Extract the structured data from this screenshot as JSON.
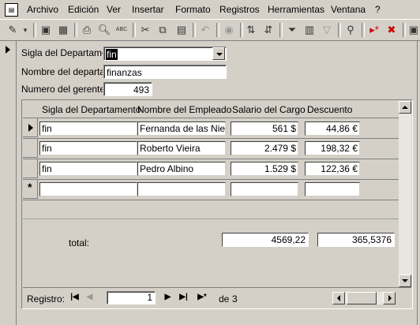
{
  "menu": {
    "items": [
      "Archivo",
      "Edición",
      "Ver",
      "Insertar",
      "Formato",
      "Registros",
      "Herramientas",
      "Ventana",
      "?"
    ]
  },
  "toolbar": {
    "icons": [
      "design-view-icon",
      "save-icon",
      "print-preview-icon",
      "print-icon",
      "preview-icon",
      "spelling-icon",
      "cut-icon",
      "copy-icon",
      "paste-icon",
      "undo-icon",
      "hyperlink-icon",
      "sort-asc-icon",
      "sort-desc-icon",
      "filter-selection-icon",
      "filter-form-icon",
      "apply-filter-icon",
      "find-icon",
      "new-record-icon",
      "delete-record-icon",
      "database-window-icon"
    ],
    "spelling_glyph": "ABC"
  },
  "form": {
    "sigla_label": "Sigla del Departamen",
    "sigla_value": "fin",
    "nombre_label": "Nombre del departam",
    "nombre_value": "finanzas",
    "gerente_label": "Numero del gerente",
    "gerente_value": "493"
  },
  "subform": {
    "headers": [
      "Sigla del Departamento",
      "Nombre del Empleado",
      "Salario del Cargo",
      "Descuento"
    ],
    "rows": [
      {
        "sigla": "fin",
        "nombre": "Fernanda de las Nieve",
        "salario": "561 $",
        "descuento": "44,86 €"
      },
      {
        "sigla": "fin",
        "nombre": "Roberto Vieira",
        "salario": "2.479 $",
        "descuento": "198,32 €"
      },
      {
        "sigla": "fin",
        "nombre": "Pedro Albino",
        "salario": "1.529 $",
        "descuento": "122,36 €"
      }
    ],
    "new_row_marker": "*",
    "total_label": "total:",
    "total_salario": "4569,22",
    "total_descuento": "365,5376"
  },
  "navigation": {
    "label": "Registro:",
    "current": "1",
    "of_label": "de",
    "total": "3"
  }
}
